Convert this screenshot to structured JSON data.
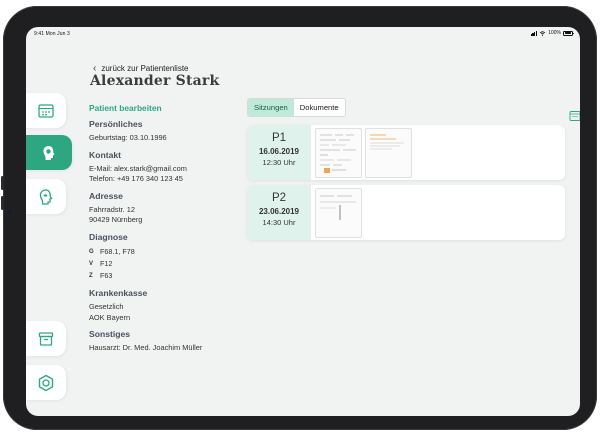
{
  "statusbar": {
    "time": "9:41 Mon Jun 3",
    "battery": "100%"
  },
  "sidebar": {
    "items": [
      {
        "name": "calendar-icon",
        "active": false
      },
      {
        "name": "patient-head-icon",
        "active": true
      },
      {
        "name": "therapy-head-icon",
        "active": false
      },
      {
        "name": "archive-icon",
        "active": false
      },
      {
        "name": "settings-hexagon-icon",
        "active": false
      }
    ]
  },
  "header": {
    "back_label": "zurück zur Patientenliste",
    "patient_name": "Alexander Stark"
  },
  "details": {
    "edit_label": "Patient bearbeiten",
    "personal": {
      "title": "Persönliches",
      "birthday": "Geburtstag: 03.10.1996"
    },
    "contact": {
      "title": "Kontakt",
      "email": "E-Mail: alex.stark@gmail.com",
      "phone": "Telefon: +49 176 340 123 45"
    },
    "address": {
      "title": "Adresse",
      "street": "Fahrradstr. 12",
      "city": "90429 Nürnberg"
    },
    "diagnosis": {
      "title": "Diagnose",
      "items": [
        {
          "letter": "G",
          "code": "F68.1, F78"
        },
        {
          "letter": "V",
          "code": "F12"
        },
        {
          "letter": "Z",
          "code": "F63"
        }
      ]
    },
    "insurance": {
      "title": "Krankenkasse",
      "type": "Gesetzlich",
      "name": "AOK Bayern"
    },
    "other": {
      "title": "Sonstiges",
      "doctor": "Hausarzt: Dr. Med. Joachim Müller"
    }
  },
  "tabs": {
    "sessions": "Sitzungen",
    "documents": "Dokumente",
    "active": "sessions"
  },
  "sessions": [
    {
      "id": "P1",
      "date": "16.06.2019",
      "time": "12:30 Uhr",
      "documents": 2
    },
    {
      "id": "P2",
      "date": "23.06.2019",
      "time": "14:30 Uhr",
      "documents": 1
    }
  ],
  "colors": {
    "accent": "#2ea781",
    "accent_light": "#dff3ec",
    "tab_active": "#bfe9d9",
    "screen_bg": "#f1f2f2"
  }
}
